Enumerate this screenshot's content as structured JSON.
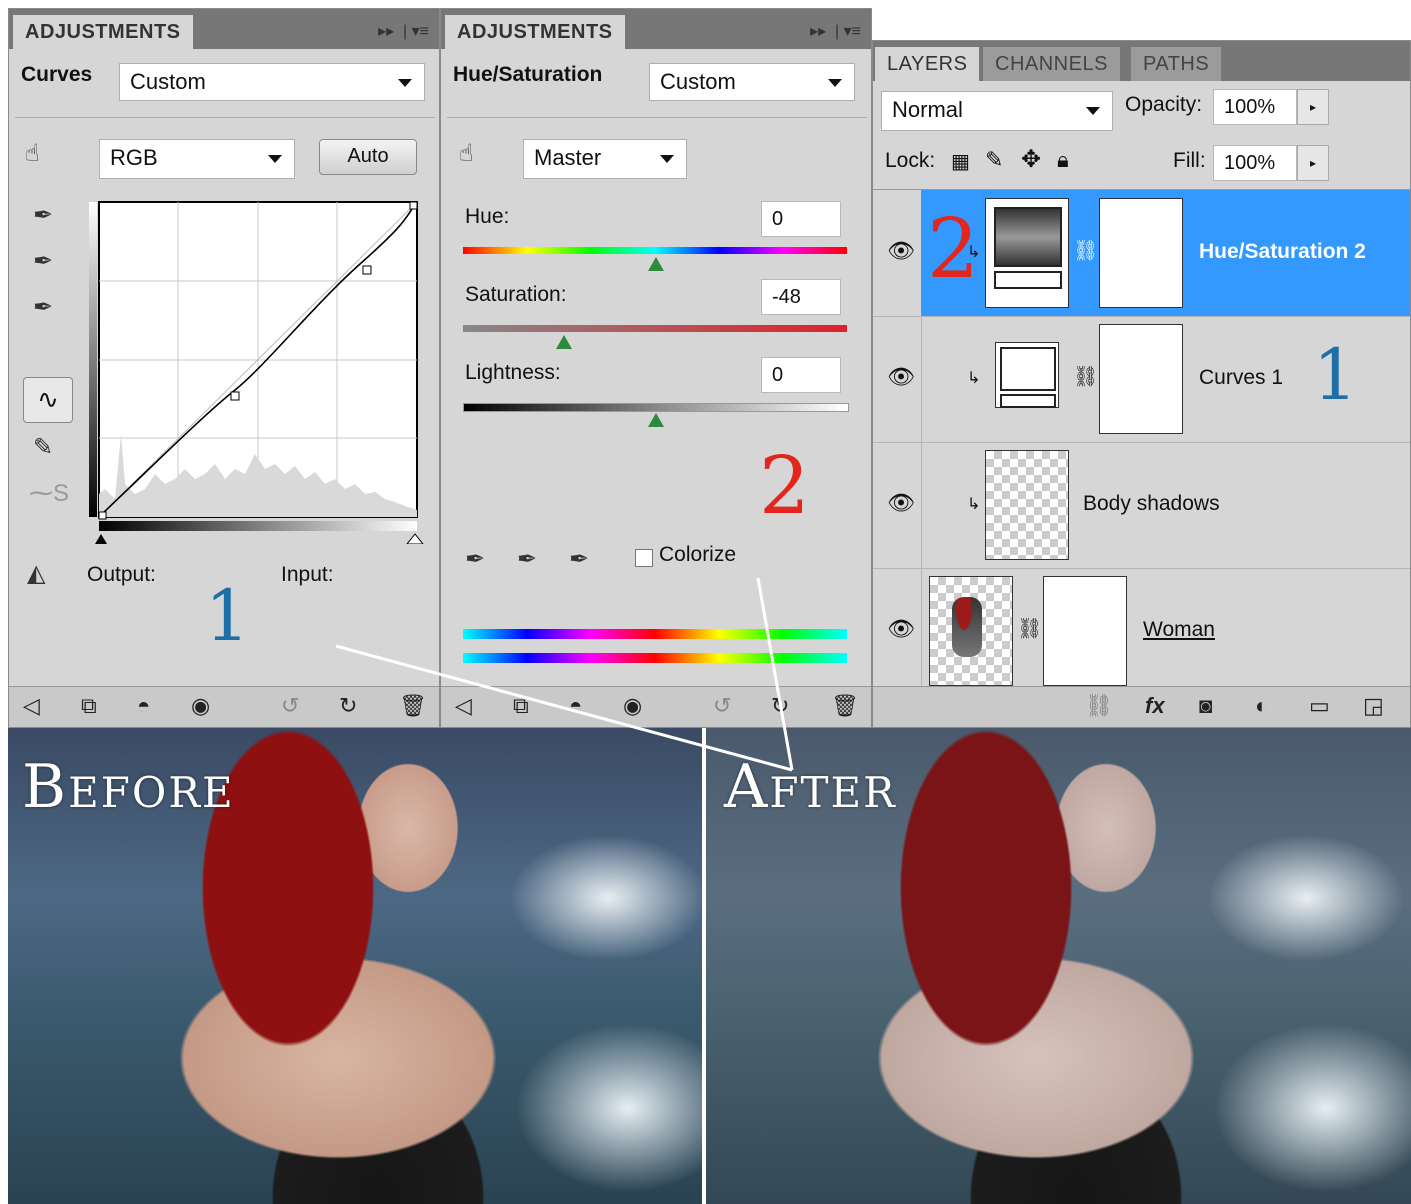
{
  "curves_panel": {
    "tab": "ADJUSTMENTS",
    "title": "Curves",
    "preset": "Custom",
    "channel": "RGB",
    "auto_label": "Auto",
    "output_label": "Output:",
    "input_label": "Input:",
    "callout": "1"
  },
  "huesat_panel": {
    "tab": "ADJUSTMENTS",
    "title": "Hue/Saturation",
    "preset": "Custom",
    "range": "Master",
    "hue_label": "Hue:",
    "hue_value": "0",
    "hue": 0,
    "saturation_label": "Saturation:",
    "saturation_value": "-48",
    "saturation": -48,
    "lightness_label": "Lightness:",
    "lightness_value": "0",
    "lightness": 0,
    "colorize_label": "Colorize",
    "colorize_checked": false,
    "callout": "2"
  },
  "layers_panel": {
    "tabs": [
      "LAYERS",
      "CHANNELS",
      "PATHS"
    ],
    "blend_mode": "Normal",
    "opacity_label": "Opacity:",
    "opacity_value": "100%",
    "lock_label": "Lock:",
    "fill_label": "Fill:",
    "fill_value": "100%",
    "layers": [
      {
        "name": "Hue/Saturation 2",
        "selected": true,
        "callout": "2"
      },
      {
        "name": "Curves 1",
        "selected": false,
        "callout": "1"
      },
      {
        "name": "Body shadows",
        "selected": false
      },
      {
        "name": "Woman",
        "selected": false
      }
    ]
  },
  "photos": {
    "before_caption": "Before",
    "after_caption": "After"
  },
  "colors": {
    "selected_row": "#3399ff",
    "callout_red": "#e2261c",
    "callout_blue": "#1e6ea8",
    "panel_bg": "#d6d6d6"
  }
}
